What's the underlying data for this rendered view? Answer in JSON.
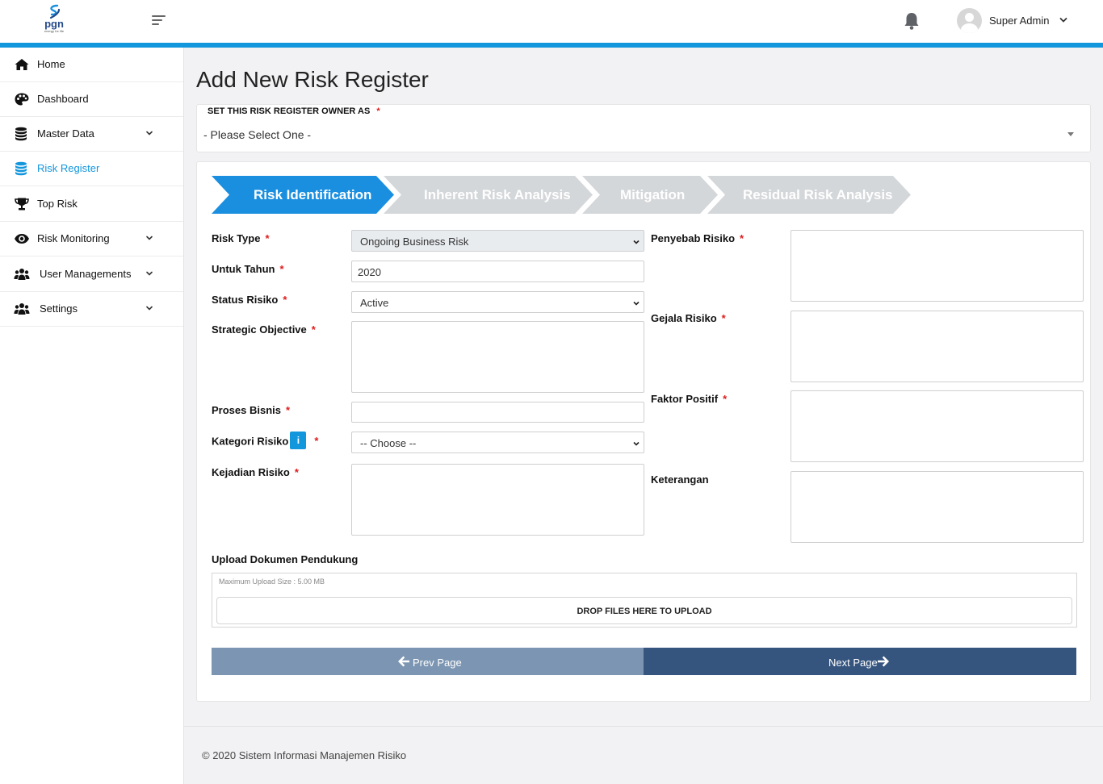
{
  "header": {
    "logo_text": "pgn",
    "logo_tagline": "energy for life",
    "user_name": "Super Admin"
  },
  "sidebar": {
    "items": [
      {
        "label": "Home",
        "icon": "home-icon"
      },
      {
        "label": "Dashboard",
        "icon": "palette-icon"
      },
      {
        "label": "Master Data",
        "icon": "database-icon",
        "expandable": true
      },
      {
        "label": "Risk Register",
        "icon": "database-icon",
        "active": true
      },
      {
        "label": "Top Risk",
        "icon": "trophy-icon"
      },
      {
        "label": "Risk Monitoring",
        "icon": "eye-icon",
        "expandable": true
      },
      {
        "label": "User Managements",
        "icon": "users-icon",
        "expandable": true
      },
      {
        "label": "Settings",
        "icon": "users-icon",
        "expandable": true
      }
    ]
  },
  "page": {
    "title": "Add New Risk Register",
    "owner_label": "SET THIS RISK REGISTER OWNER AS",
    "owner_value": "- Please Select One -"
  },
  "steps": [
    {
      "label": "Risk Identification",
      "active": true
    },
    {
      "label": "Inherent Risk Analysis",
      "active": false
    },
    {
      "label": "Mitigation",
      "active": false
    },
    {
      "label": "Residual Risk Analysis",
      "active": false
    }
  ],
  "form": {
    "risk_type": {
      "label": "Risk Type",
      "value": "Ongoing Business Risk"
    },
    "untuk_tahun": {
      "label": "Untuk Tahun",
      "value": "2020"
    },
    "status_risiko": {
      "label": "Status Risiko",
      "value": "Active"
    },
    "strategic_objective": {
      "label": "Strategic Objective",
      "value": ""
    },
    "proses_bisnis": {
      "label": "Proses Bisnis",
      "value": ""
    },
    "kategori_risiko": {
      "label": "Kategori Risiko",
      "value": "-- Choose --",
      "info": "i"
    },
    "kejadian_risiko": {
      "label": "Kejadian Risiko",
      "value": ""
    },
    "penyebab_risiko": {
      "label": "Penyebab Risiko",
      "value": ""
    },
    "gejala_risiko": {
      "label": "Gejala Risiko",
      "value": ""
    },
    "faktor_positif": {
      "label": "Faktor Positif",
      "value": ""
    },
    "keterangan": {
      "label": "Keterangan",
      "value": ""
    },
    "required_mark": "*"
  },
  "upload": {
    "label": "Upload Dokumen Pendukung",
    "hint": "Maximum Upload Size : 5.00 MB",
    "drop_text": "DROP FILES HERE TO UPLOAD"
  },
  "buttons": {
    "prev": "Prev Page",
    "next": "Next Page"
  },
  "footer": {
    "text": "© 2020 Sistem Informasi Manajemen Risiko"
  },
  "colors": {
    "accent": "#1296dc",
    "step_active": "#1a8fe0",
    "step_inactive": "#d4d7da",
    "prev_button": "#7b95b2",
    "next_button": "#35557f",
    "required": "#e01b1b"
  }
}
